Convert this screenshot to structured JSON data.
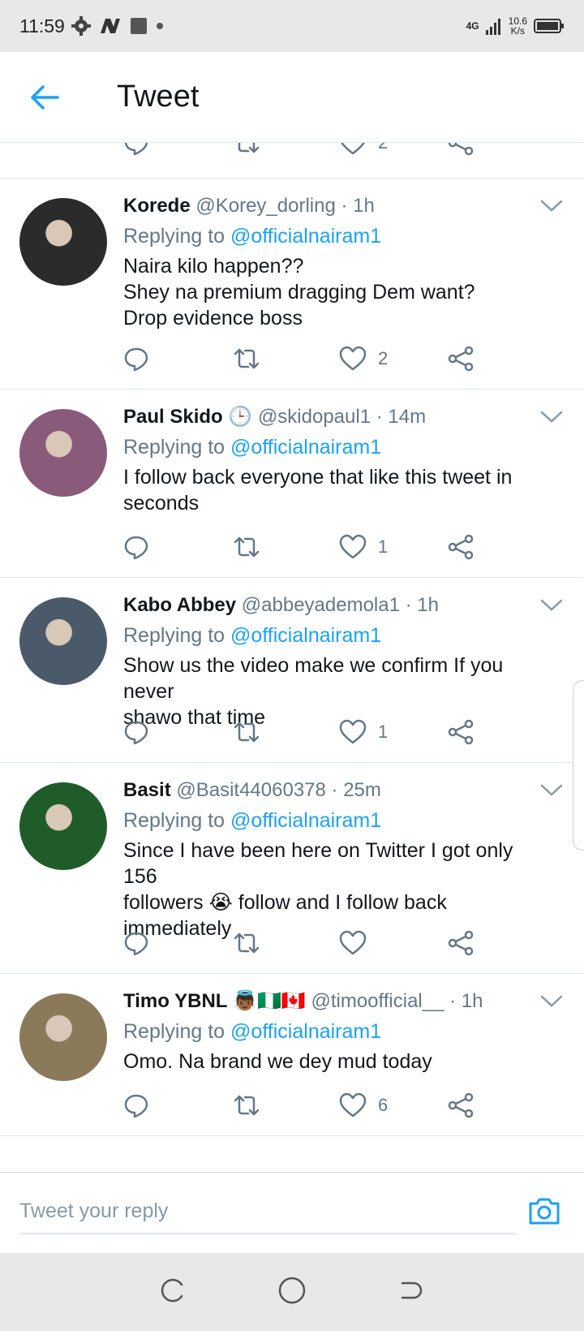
{
  "status_bar": {
    "time": "11:59",
    "network": "4G",
    "speed": "10.6",
    "speed_unit": "K/s"
  },
  "header": {
    "title": "Tweet"
  },
  "tweets": [
    {
      "name": "Korede",
      "handle": "@Korey_dorling",
      "time": "· 1h",
      "reply_prefix": "Replying to",
      "reply_handle": "@officialnairam1",
      "lines": [
        "Naira kilo happen??",
        "Shey na premium dragging Dem want?",
        "Drop evidence boss"
      ],
      "likes": "2",
      "avatar_color": "#2b2b2b"
    },
    {
      "name": "Paul Skido",
      "name_emoji": "🕒",
      "handle": "@skidopaul1",
      "time": "· 14m",
      "reply_prefix": "Replying to",
      "reply_handle": "@officialnairam1",
      "lines": [
        "I follow back everyone that like this tweet in",
        "seconds"
      ],
      "likes": "1",
      "avatar_color": "#8a5a7a"
    },
    {
      "name": "Kabo Abbey",
      "handle": "@abbeyademola1",
      "time": "· 1h",
      "reply_prefix": "Replying to",
      "reply_handle": "@officialnairam1",
      "lines": [
        "Show us the video make we confirm If you never",
        "shawo that time"
      ],
      "likes": "1",
      "avatar_color": "#4a5a6a"
    },
    {
      "name": "Basit",
      "handle": "@Basit44060378",
      "time": "· 25m",
      "reply_prefix": "Replying to",
      "reply_handle": "@officialnairam1",
      "lines": [
        "Since I have been here on Twitter I got only 156",
        "followers 😭 follow and I follow back",
        "immediately"
      ],
      "likes": "",
      "avatar_color": "#1f5c2a"
    },
    {
      "name": "Timo YBNL",
      "name_emoji": "👼🏾🇳🇬🇨🇦",
      "handle": "@timoofficial__",
      "time": "· 1h",
      "reply_prefix": "Replying to",
      "reply_handle": "@officialnairam1",
      "lines": [
        "Omo. Na brand we dey mud today"
      ],
      "likes": "6",
      "avatar_color": "#8a7a5a"
    }
  ],
  "top_partial": {
    "likes": "2"
  },
  "composer": {
    "placeholder": "Tweet your reply"
  },
  "colors": {
    "accent": "#1da1f2",
    "muted": "#657786",
    "text": "#14171a",
    "divider": "#e1e8ed"
  },
  "icons": {
    "back": "arrow-left-icon",
    "reply": "comment-icon",
    "retweet": "retweet-icon",
    "like": "heart-icon",
    "share": "share-icon",
    "caret": "chevron-down-icon",
    "camera": "camera-icon"
  }
}
